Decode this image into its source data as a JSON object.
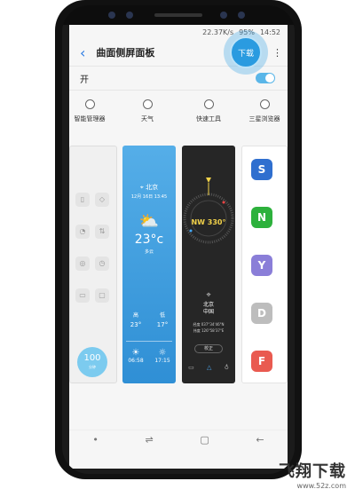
{
  "status": {
    "speed": "22.37K/s",
    "battery": "95%",
    "time": "14:52"
  },
  "header": {
    "back_icon": "chevron-left-icon",
    "title": "曲面侧屏面板",
    "action_label": "下载",
    "more_icon": "more-vertical-icon"
  },
  "toggle": {
    "label": "开",
    "on": true
  },
  "panels": [
    {
      "label": "智能管理器",
      "selected": false
    },
    {
      "label": "天气",
      "selected": false
    },
    {
      "label": "快速工具",
      "selected": false
    },
    {
      "label": "三星浏览器",
      "selected": false
    }
  ],
  "device_panel": {
    "score": "100",
    "score_unit": "分钟"
  },
  "weather": {
    "city": "北京",
    "date": "12月 16日 13:45",
    "temp": "23°c",
    "condition": "多云",
    "high_label": "高",
    "low_label": "低",
    "high": "23°",
    "low": "17°",
    "sunrise": "06:58",
    "sunset": "17:15"
  },
  "tools": {
    "heading": "NW 330°",
    "city": "北京",
    "country": "中国",
    "lat": "经度 037°34'46\"N",
    "lon": "纬度 126°58'37\"E",
    "calibrate": "校正"
  },
  "browser_tiles": [
    {
      "letter": "S",
      "color": "#2f6fcf"
    },
    {
      "letter": "N",
      "color": "#2db13c"
    },
    {
      "letter": "Y",
      "color": "#8a7ed8"
    },
    {
      "letter": "D",
      "color": "#bdbdbd"
    },
    {
      "letter": "F",
      "color": "#e95a50"
    }
  ],
  "watermark": {
    "title": "飞翔下载",
    "url": "www.52z.com"
  },
  "colors": {
    "accent": "#2a9be0",
    "switch_on": "#5ab6e8"
  }
}
